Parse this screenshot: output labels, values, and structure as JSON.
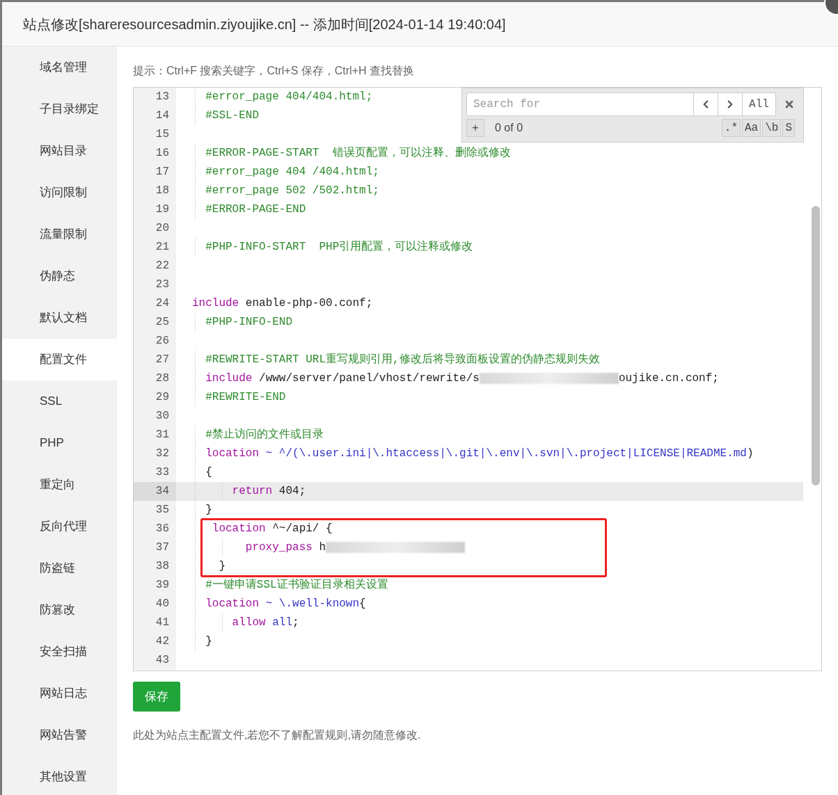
{
  "title": "站点修改[shareresourcesadmin.ziyoujike.cn] -- 添加时间[2024-01-14 19:40:04]",
  "sidebar": {
    "items": [
      {
        "label": "域名管理",
        "selected": false
      },
      {
        "label": "子目录绑定",
        "selected": false
      },
      {
        "label": "网站目录",
        "selected": false
      },
      {
        "label": "访问限制",
        "selected": false
      },
      {
        "label": "流量限制",
        "selected": false
      },
      {
        "label": "伪静态",
        "selected": false
      },
      {
        "label": "默认文档",
        "selected": false
      },
      {
        "label": "配置文件",
        "selected": true
      },
      {
        "label": "SSL",
        "selected": false
      },
      {
        "label": "PHP",
        "selected": false
      },
      {
        "label": "重定向",
        "selected": false
      },
      {
        "label": "反向代理",
        "selected": false
      },
      {
        "label": "防盗链",
        "selected": false
      },
      {
        "label": "防篡改",
        "selected": false
      },
      {
        "label": "安全扫描",
        "selected": false
      },
      {
        "label": "网站日志",
        "selected": false
      },
      {
        "label": "网站告警",
        "selected": false
      },
      {
        "label": "其他设置",
        "selected": false
      }
    ]
  },
  "hint": "提示：Ctrl+F 搜索关键字，Ctrl+S 保存，Ctrl+H 查找替换",
  "editor": {
    "lines": [
      {
        "number": "13",
        "active": false,
        "tokens": [
          {
            "kind": "comment",
            "text": "  #error_page 404/404.html;"
          }
        ]
      },
      {
        "number": "14",
        "active": false,
        "tokens": [
          {
            "kind": "comment",
            "text": "  #SSL-END"
          }
        ]
      },
      {
        "number": "15",
        "active": false
      },
      {
        "number": "16",
        "active": false,
        "tokens": [
          {
            "kind": "comment",
            "text": "  #ERROR-PAGE-START  错误页配置，可以注释、删除或修改"
          }
        ]
      },
      {
        "number": "17",
        "active": false,
        "tokens": [
          {
            "kind": "comment",
            "text": "  #error_page 404 /404.html;"
          }
        ]
      },
      {
        "number": "18",
        "active": false,
        "tokens": [
          {
            "kind": "comment",
            "text": "  #error_page 502 /502.html;"
          }
        ]
      },
      {
        "number": "19",
        "active": false,
        "tokens": [
          {
            "kind": "comment",
            "text": "  #ERROR-PAGE-END"
          }
        ]
      },
      {
        "number": "20",
        "active": false
      },
      {
        "number": "21",
        "active": false,
        "tokens": [
          {
            "kind": "comment",
            "text": "  #PHP-INFO-START  PHP引用配置，可以注释或修改"
          }
        ]
      },
      {
        "number": "22",
        "active": false
      },
      {
        "number": "23",
        "active": false
      },
      {
        "number": "24",
        "active": false,
        "tokens": [
          {
            "kind": "keyword",
            "text": "include"
          },
          {
            "kind": "plain",
            "text": " enable-php-00.conf;"
          }
        ]
      },
      {
        "number": "25",
        "active": false,
        "tokens": [
          {
            "kind": "comment",
            "text": "  #PHP-INFO-END"
          }
        ]
      },
      {
        "number": "26",
        "active": false
      },
      {
        "number": "27",
        "active": false,
        "tokens": [
          {
            "kind": "comment",
            "text": "  #REWRITE-START URL重写规则引用,修改后将导致面板设置的伪静态规则失效"
          }
        ]
      },
      {
        "number": "28",
        "active": false,
        "tokens": [
          {
            "kind": "keyword",
            "text": "  include"
          },
          {
            "kind": "plain",
            "text": " /www/server/panel/vhost/rewrite/s"
          },
          {
            "kind": "blur"
          },
          {
            "kind": "plain",
            "text": "oujike.cn.conf;"
          }
        ]
      },
      {
        "number": "29",
        "active": false,
        "tokens": [
          {
            "kind": "comment",
            "text": "  #REWRITE-END"
          }
        ]
      },
      {
        "number": "30",
        "active": false
      },
      {
        "number": "31",
        "active": false,
        "tokens": [
          {
            "kind": "comment",
            "text": "  #禁止访问的文件或目录"
          }
        ]
      },
      {
        "number": "32",
        "active": false,
        "tokens": [
          {
            "kind": "keyword",
            "text": "  location"
          },
          {
            "kind": "operator",
            "text": " ~ ^/(\\.user.ini|\\.htaccess|\\.git|\\.env|\\.svn|\\.project|LICENSE|README.md"
          },
          {
            "kind": "plain",
            "text": ")"
          }
        ]
      },
      {
        "number": "33",
        "active": false,
        "tokens": [
          {
            "kind": "plain",
            "text": "  {"
          }
        ]
      },
      {
        "number": "34",
        "active": true,
        "tokens": [
          {
            "kind": "keyword",
            "text": "      return"
          },
          {
            "kind": "plain",
            "text": " 404;"
          }
        ]
      },
      {
        "number": "35",
        "active": false,
        "tokens": [
          {
            "kind": "plain",
            "text": "  }"
          }
        ]
      },
      {
        "number": "36",
        "active": false,
        "tokens": [
          {
            "kind": "keyword",
            "text": "   location"
          },
          {
            "kind": "plain",
            "text": " ^~/api/ {"
          }
        ]
      },
      {
        "number": "37",
        "active": false,
        "tokens": [
          {
            "kind": "keyword",
            "text": "        proxy_pass"
          },
          {
            "kind": "plain",
            "text": " h"
          },
          {
            "kind": "blur"
          }
        ]
      },
      {
        "number": "38",
        "active": false,
        "tokens": [
          {
            "kind": "plain",
            "text": "    }"
          }
        ]
      },
      {
        "number": "39",
        "active": false,
        "tokens": [
          {
            "kind": "comment",
            "text": "  #一键申请SSL证书验证目录相关设置"
          }
        ]
      },
      {
        "number": "40",
        "active": false,
        "tokens": [
          {
            "kind": "keyword",
            "text": "  location"
          },
          {
            "kind": "operator",
            "text": " ~ \\.well-known"
          },
          {
            "kind": "plain",
            "text": "{"
          }
        ]
      },
      {
        "number": "41",
        "active": false,
        "tokens": [
          {
            "kind": "keyword",
            "text": "      allow"
          },
          {
            "kind": "operator",
            "text": " all"
          },
          {
            "kind": "plain",
            "text": ";"
          }
        ]
      },
      {
        "number": "42",
        "active": false,
        "tokens": [
          {
            "kind": "plain",
            "text": "  }"
          }
        ]
      },
      {
        "number": "43",
        "active": false
      }
    ]
  },
  "search_panel": {
    "placeholder": "Search for",
    "all_button": "All",
    "add_button": "+",
    "count": "0 of 0",
    "toggles": [
      ".*",
      "Aa",
      "\\b",
      "S"
    ]
  },
  "save_button": "保存",
  "note": "此处为站点主配置文件,若您不了解配置规则,请勿随意修改."
}
